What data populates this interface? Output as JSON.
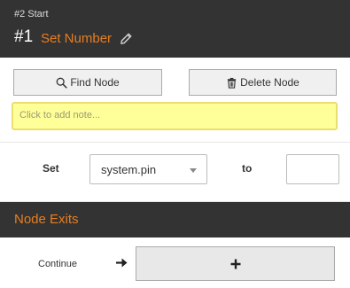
{
  "header": {
    "subtitle": "#2 Start",
    "node_number": "#1",
    "node_title": "Set Number"
  },
  "actions": {
    "find_label": "Find Node",
    "delete_label": "Delete Node"
  },
  "note": {
    "placeholder": "Click to add note..."
  },
  "assignment": {
    "set_label": "Set",
    "variable": "system.pin",
    "to_label": "to",
    "value": ""
  },
  "exits": {
    "title": "Node Exits",
    "items": [
      {
        "label": "Continue"
      }
    ]
  },
  "colors": {
    "header_bg": "#333333",
    "accent": "#e67e22",
    "note_bg": "#ffff99",
    "note_border": "#e8df70"
  }
}
